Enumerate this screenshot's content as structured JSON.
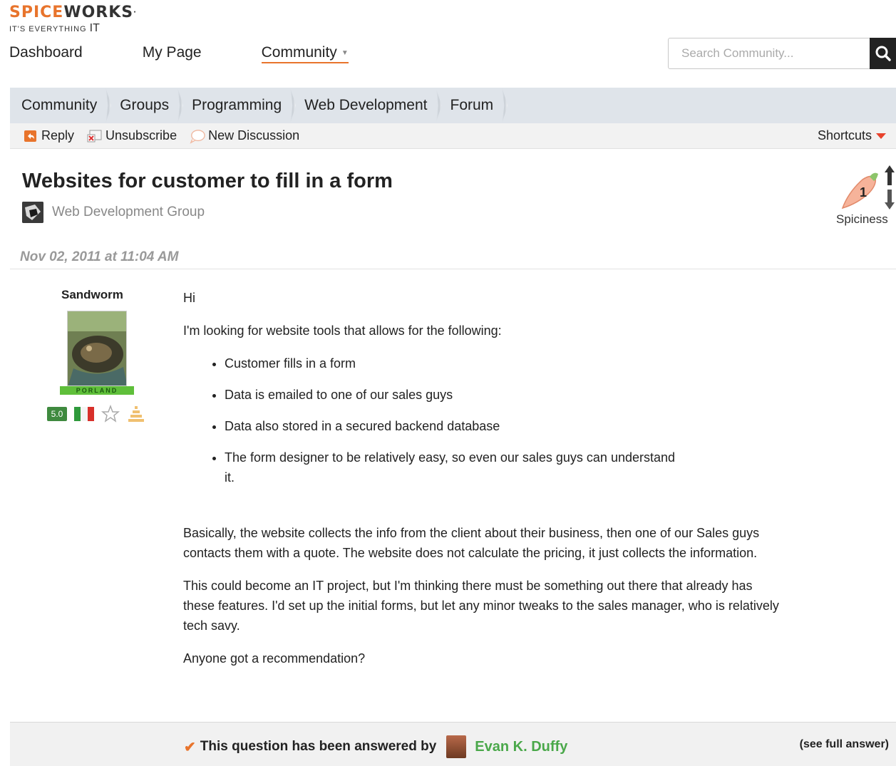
{
  "logo": {
    "brand_spice": "SPICE",
    "brand_works": "WORKS",
    "tm": "·",
    "tagline_prefix": "IT'S EVERYTHING",
    "tagline_it": "IT"
  },
  "topnav": {
    "items": [
      {
        "label": "Dashboard"
      },
      {
        "label": "My Page"
      },
      {
        "label": "Community"
      }
    ]
  },
  "search": {
    "placeholder": "Search Community..."
  },
  "breadcrumb": [
    {
      "label": "Community"
    },
    {
      "label": "Groups"
    },
    {
      "label": "Programming"
    },
    {
      "label": "Web Development"
    },
    {
      "label": "Forum"
    }
  ],
  "actions": {
    "reply": "Reply",
    "unsubscribe": "Unsubscribe",
    "new_discussion": "New Discussion",
    "shortcuts": "Shortcuts"
  },
  "topic": {
    "title": "Websites for customer to fill in a form",
    "group": "Web Development Group",
    "spiciness_label": "Spiciness",
    "spiciness_value": "1",
    "date": "Nov 02, 2011 at 11:04 AM"
  },
  "author": {
    "name": "Sandworm",
    "badge_text": "PORLAND",
    "score": "5.0"
  },
  "post": {
    "greeting": "Hi",
    "intro": "I'm looking for website tools that allows for the following:",
    "bullets": [
      "Customer fills in a form",
      "Data is emailed to one of our sales guys",
      "Data also stored in a secured backend database",
      "The form designer to be relatively easy, so even our sales guys can understand it."
    ],
    "para1": "Basically, the website collects the info from the client about their business, then one of our Sales guys contacts them with a quote. The website does not calculate the pricing, it just collects the information.",
    "para2": "This could become an IT project, but I'm thinking there must be something out there that already has these features. I'd set up the initial forms, but let any minor tweaks to the sales manager, who is relatively tech savy.",
    "para3": "Anyone got a recommendation?"
  },
  "answered": {
    "message": "This question has been answered by",
    "answerer": "Evan K. Duffy",
    "see_full": "(see full answer)"
  },
  "colors": {
    "accent": "#e8742c",
    "breadcrumb_bg": "#dfe4ea",
    "answer_green": "#4aa84a"
  }
}
